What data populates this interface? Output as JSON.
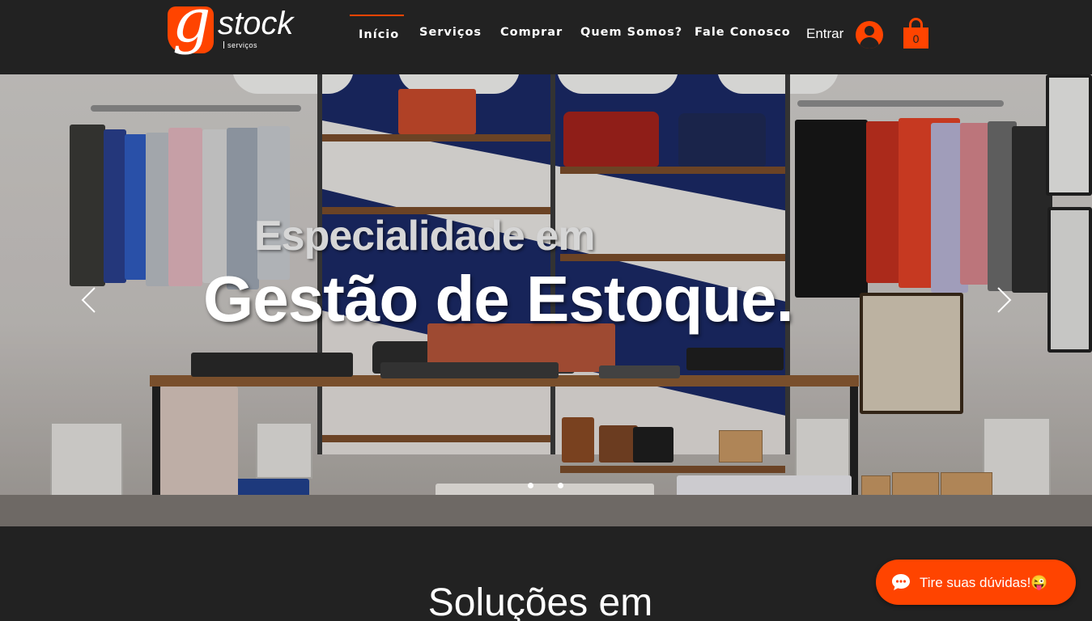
{
  "header": {
    "logo": {
      "letter": "g",
      "word": "stock",
      "sub": "serviços"
    },
    "nav": [
      {
        "label": "Início",
        "active": true
      },
      {
        "label": "Serviços",
        "active": false
      },
      {
        "label": "Comprar",
        "active": false
      },
      {
        "label": "Quem Somos?",
        "active": false
      },
      {
        "label": "Fale Conosco",
        "active": false
      }
    ],
    "login_label": "Entrar",
    "user_icon": "user-avatar-icon",
    "cart_icon": "shopping-bag-icon",
    "cart_count": "0"
  },
  "hero": {
    "line1": "Especialidade em",
    "line2": "Gestão de Estoque.",
    "prev_icon": "chevron-left-icon",
    "next_icon": "chevron-right-icon",
    "slides_total": 2,
    "active_slide": 1
  },
  "section": {
    "title": "Soluções em"
  },
  "chat": {
    "label": "Tire suas dúvidas!😜",
    "icon": "chat-bubble-icon"
  },
  "colors": {
    "accent": "#ff4400",
    "background": "#222222",
    "text": "#ffffff"
  }
}
